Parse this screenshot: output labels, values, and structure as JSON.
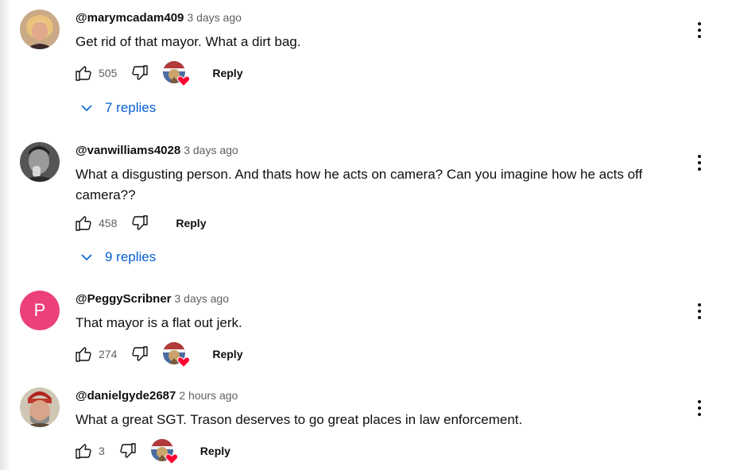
{
  "comments": [
    {
      "author": "@marymcadam409",
      "time": "3 days ago",
      "text": "Get rid of that mayor.  What a dirt bag.",
      "likes": "505",
      "creator_heart": true,
      "reply_label": "Reply",
      "replies_label": "7 replies",
      "avatar_icon": "photo-avatar-blonde"
    },
    {
      "author": "@vanwilliams4028",
      "time": "3 days ago",
      "text": "What a disgusting person. And thats how he acts on camera? Can you imagine how he acts off camera??",
      "likes": "458",
      "creator_heart": false,
      "reply_label": "Reply",
      "replies_label": "9 replies",
      "avatar_icon": "photo-avatar-bw"
    },
    {
      "author": "@PeggyScribner",
      "time": "3 days ago",
      "text": "That mayor is a flat out jerk.",
      "likes": "274",
      "creator_heart": true,
      "reply_label": "Reply",
      "avatar_letter": "P",
      "avatar_color": "#ec407a"
    },
    {
      "author": "@danielgyde2687",
      "time": "2 hours ago",
      "text": "What a great SGT. Trason deserves to go great places in law enforcement.",
      "likes": "3",
      "creator_heart": true,
      "reply_label": "Reply",
      "avatar_icon": "photo-avatar-beanie"
    }
  ],
  "colors": {
    "link": "#065fd4",
    "secondary_text": "#606060",
    "heart": "#ff0033",
    "letter_avatar": "#ec407a"
  }
}
